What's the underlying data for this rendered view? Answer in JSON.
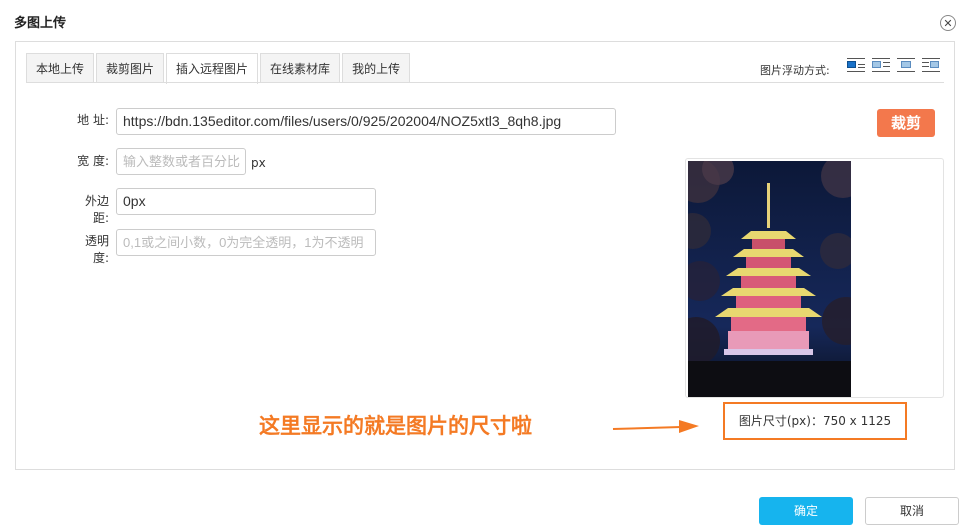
{
  "dialog": {
    "title": "多图上传",
    "close_icon": "close-icon"
  },
  "tabs": [
    {
      "label": "本地上传",
      "active": false
    },
    {
      "label": "裁剪图片",
      "active": false
    },
    {
      "label": "插入远程图片",
      "active": true
    },
    {
      "label": "在线素材库",
      "active": false
    },
    {
      "label": "我的上传",
      "active": false
    }
  ],
  "float_options": {
    "label": "图片浮动方式:",
    "icons": [
      "float-none-icon",
      "float-left-icon",
      "float-center-icon",
      "float-right-icon"
    ],
    "selected": "float-none-icon"
  },
  "form": {
    "address": {
      "label": "地 址:",
      "value": "https://bdn.135editor.com/files/users/0/925/202004/NOZ5xtl3_8qh8.jpg"
    },
    "width": {
      "label": "宽 度:",
      "placeholder": "输入整数或者百分比",
      "unit": "px"
    },
    "margin": {
      "label": "外边距:",
      "value": "0px"
    },
    "opacity": {
      "label": "透明度:",
      "placeholder": "0,1或之间小数，0为完全透明，1为不透明"
    }
  },
  "crop_button": {
    "label": "裁剪",
    "color": "#f3784c"
  },
  "preview": {
    "image_icon": "pagoda-photo-icon",
    "size_text": "图片尺寸(px)：750 x 1125"
  },
  "annotation": {
    "text": "这里显示的就是图片的尺寸啦",
    "color": "#f47a24"
  },
  "footer": {
    "ok_label": "确定",
    "cancel_label": "取消",
    "ok_color": "#16b4ee"
  }
}
